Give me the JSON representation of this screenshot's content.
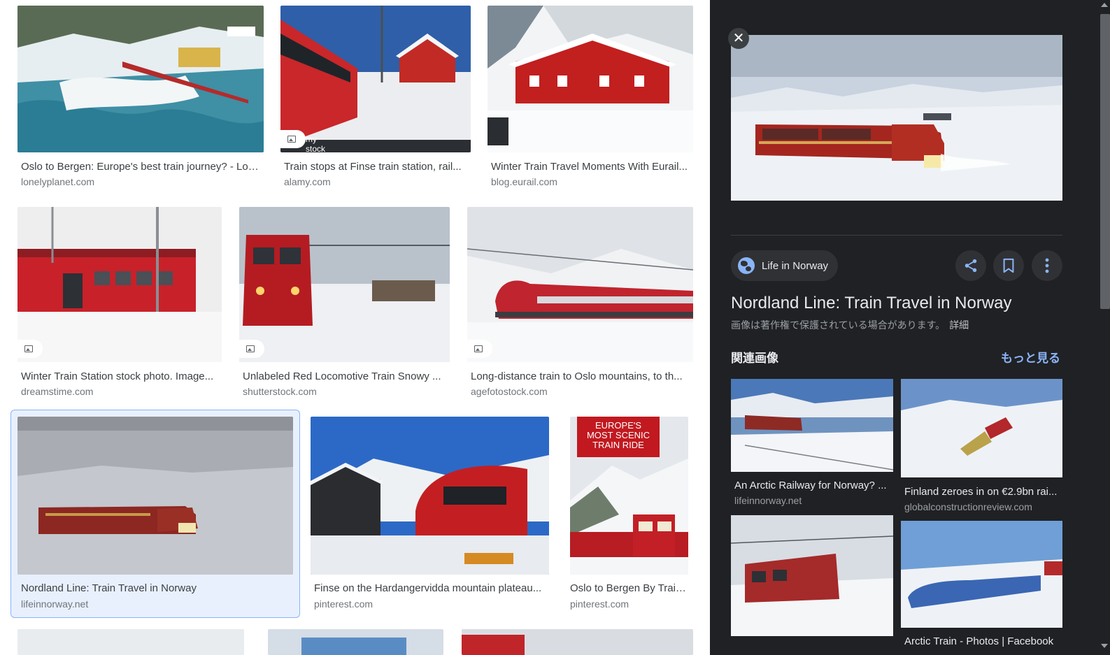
{
  "results": [
    {
      "title": "Oslo to Bergen: Europe's best train journey? - Lon...",
      "source": "lonelyplanet.com",
      "image": "snowy-river-train-aerial",
      "badge": ""
    },
    {
      "title": "Train stops at Finse train station, rail...",
      "source": "alamy.com",
      "image": "finse-station-red-house",
      "badge": "my stock photo"
    },
    {
      "title": "Winter Train Travel Moments With Eurail...",
      "source": "blog.eurail.com",
      "image": "red-station-building-snow",
      "badge": ""
    },
    {
      "title": "Winter Train Station stock photo. Image...",
      "source": "dreamstime.com",
      "image": "red-train-snowfall-station",
      "badge": ""
    },
    {
      "title": "Unlabeled Red Locomotive Train Snowy ...",
      "source": "shutterstock.com",
      "image": "red-locomotive-front-snow",
      "badge": ""
    },
    {
      "title": "Long-distance train to Oslo mountains, to th...",
      "source": "agefotostock.com",
      "image": "red-passenger-train-mountains",
      "badge": ""
    },
    {
      "title": "Nordland Line: Train Travel in Norway",
      "source": "lifeinnorway.net",
      "image": "nordland-train-snow-plain",
      "badge": ""
    },
    {
      "title": "Finse on the Hardangervidda mountain plateau...",
      "source": "pinterest.com",
      "image": "finse-red-train-platform",
      "badge": ""
    },
    {
      "title": "Oslo to Bergen By Train...",
      "source": "pinterest.com",
      "image": "scenic-train-ride-poster",
      "badge": ""
    }
  ],
  "poster_text": [
    "EUROPE'S",
    "MOST SCENIC",
    "TRAIN RIDE"
  ],
  "panel": {
    "close_label": "✕",
    "site_name": "Life in Norway",
    "title": "Nordland Line: Train Travel in Norway",
    "copyright_notice": "画像は著作権で保護されている場合があります。",
    "details_label": "詳細",
    "related_heading": "関連画像",
    "more_label": "もっと見る",
    "share_icon": "share-icon",
    "save_icon": "bookmark-icon",
    "more_icon": "more-vert-icon"
  },
  "related": [
    {
      "title": "An Arctic Railway for Norway? ...",
      "source": "lifeinnorway.net"
    },
    {
      "title": "Finland zeroes in on €2.9bn rai...",
      "source": "globalconstructionreview.com"
    },
    {
      "title": "Arctic Train - Photos | Facebook",
      "source": ""
    }
  ],
  "colors": {
    "panel_bg": "#202124",
    "accent_blue": "#8ab4f8",
    "selected_bg": "#e8f0fe"
  }
}
